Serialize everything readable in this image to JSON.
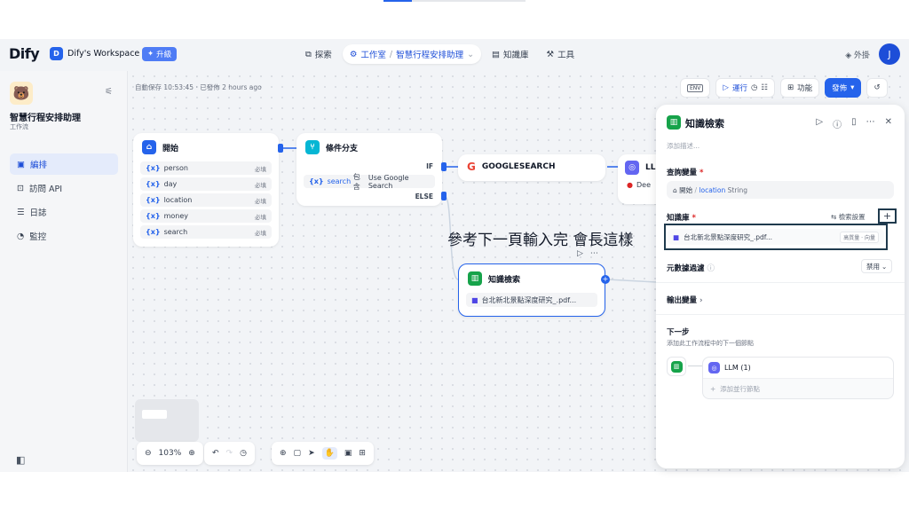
{
  "header": {
    "logo": "Dify",
    "workspace_letter": "D",
    "workspace_name": "Dify's Workspace",
    "upgrade": "升級",
    "nav": [
      {
        "label": "探索"
      },
      {
        "label": "工作室"
      },
      {
        "label": "智慧行程安排助理"
      },
      {
        "label": "知識庫"
      },
      {
        "label": "工具"
      }
    ],
    "plugins": "外掛",
    "avatar": "J"
  },
  "sidebar": {
    "app_name": "智慧行程安排助理",
    "app_type": "工作流",
    "items": [
      {
        "label": "編排"
      },
      {
        "label": "訪問 API"
      },
      {
        "label": "日誌"
      },
      {
        "label": "監控"
      }
    ]
  },
  "canvas": {
    "autosave": "自動保存 10:53:45 · 已發佈 2 hours ago",
    "toolbar": {
      "env": "ENV",
      "run": "運行",
      "features": "功能",
      "publish": "發佈"
    },
    "overlay": "參考下一頁輸入完 會長這樣",
    "zoom": "103%"
  },
  "nodes": {
    "start": {
      "title": "開始",
      "required": "必填",
      "vars": [
        "person",
        "day",
        "location",
        "money",
        "search"
      ]
    },
    "branch": {
      "title": "條件分支",
      "if": "IF",
      "else": "ELSE",
      "cond_var": "search",
      "cond_op": "包含",
      "cond_val": "Use Google Search"
    },
    "google": {
      "title": "GOOGLESEARCH"
    },
    "llm": {
      "title": "LLM",
      "sub": "Dee"
    },
    "knowledge": {
      "title": "知識檢索",
      "file": "台北新北景點深度研究_.pdf..."
    }
  },
  "panel": {
    "title": "知識檢索",
    "desc_placeholder": "添加描述...",
    "query_label": "查詢變量",
    "query_source": "開始",
    "query_var": "location",
    "query_type": "String",
    "kb_label": "知識庫",
    "retrieval_settings": "檢索設置",
    "kb_file": "台北新北景點深度研究_.pdf...",
    "kb_tag": "高質量 · 向量",
    "metadata_label": "元數據過濾",
    "metadata_value": "禁用",
    "output_label": "輸出變量",
    "next_title": "下一步",
    "next_desc": "添加此工作流程中的下一個節點",
    "next_node": "LLM (1)",
    "add_parallel": "添加並行節點"
  },
  "colors": {
    "accent": "#2563eb",
    "knowledge": "#16a34a",
    "branch": "#06b6d4",
    "llm": "#6366f1"
  }
}
